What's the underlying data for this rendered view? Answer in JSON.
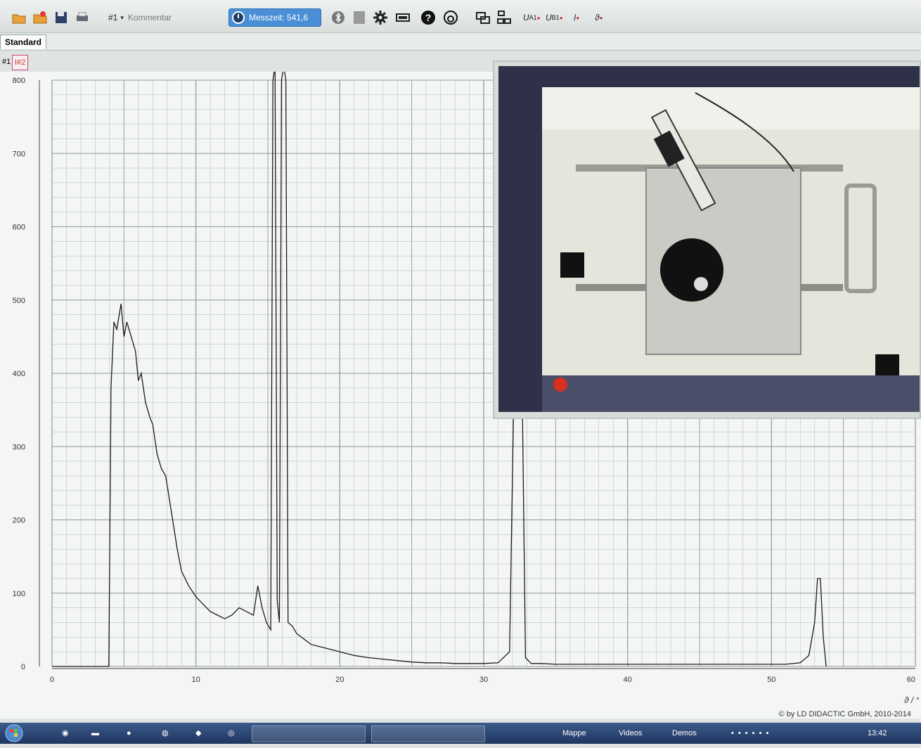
{
  "toolbar": {
    "channel": "#1",
    "comment": "Kommentar",
    "measure_time": "Messzeit: 541,6",
    "ua1": "U",
    "ua1_sub": "A1",
    "ub1": "U",
    "ub1_sub": "B1",
    "i_label": "I",
    "theta_label": "ϑ"
  },
  "tabs": {
    "standard": "Standard"
  },
  "subtabs": {
    "first": "#1",
    "second": "I#2"
  },
  "chart_data": {
    "type": "line",
    "xlabel": "ϑ / °",
    "ylabel": "",
    "xlim": [
      0,
      60
    ],
    "ylim": [
      0,
      800
    ],
    "x_ticks": [
      0,
      10,
      20,
      30,
      40,
      50,
      60
    ],
    "y_ticks": [
      0,
      100,
      200,
      300,
      400,
      500,
      600,
      700,
      800
    ],
    "grid": true,
    "series": [
      {
        "x": [
          0,
          1,
          2,
          3,
          3.95,
          4.1,
          4.3,
          4.5,
          4.8,
          5.0,
          5.2,
          5.5,
          5.8,
          6.0,
          6.2,
          6.5,
          6.8,
          7.0,
          7.3,
          7.6,
          7.9,
          8.3,
          8.7,
          9.0,
          9.5,
          10.0,
          10.5,
          11.0,
          11.5,
          12.0,
          12.5,
          13.0,
          13.5,
          14.0,
          14.3,
          14.6,
          14.9,
          15.2,
          15.35,
          15.5,
          15.65,
          15.8,
          15.95,
          16.1,
          16.25,
          16.4,
          16.7,
          17.0,
          18,
          19,
          20,
          21,
          22,
          23,
          24,
          25,
          26,
          27,
          28,
          29,
          30,
          31,
          31.8,
          32.2,
          32.4,
          32.6,
          32.9,
          33.3,
          34,
          35,
          36,
          37,
          38,
          39,
          40,
          41,
          42,
          43,
          44,
          45,
          46,
          47,
          48,
          49,
          50,
          51,
          52,
          52.6,
          53.0,
          53.2,
          53.4,
          53.6,
          53.8
        ],
        "y": [
          0,
          0,
          0,
          0,
          0,
          380,
          470,
          460,
          495,
          450,
          470,
          450,
          430,
          390,
          400,
          360,
          340,
          330,
          290,
          270,
          260,
          210,
          160,
          130,
          110,
          95,
          85,
          75,
          70,
          65,
          70,
          80,
          75,
          70,
          110,
          80,
          60,
          50,
          800,
          1500,
          90,
          60,
          800,
          1500,
          800,
          60,
          55,
          45,
          30,
          25,
          20,
          15,
          12,
          10,
          8,
          6,
          5,
          5,
          4,
          4,
          4,
          5,
          20,
          500,
          1200,
          500,
          12,
          4,
          4,
          3,
          3,
          3,
          3,
          3,
          3,
          3,
          3,
          3,
          3,
          3,
          3,
          3,
          3,
          3,
          3,
          3,
          5,
          15,
          60,
          120,
          120,
          40,
          0
        ]
      }
    ]
  },
  "copyright": "© by LD DIDACTIC GmbH, 2010-2014",
  "taskbar": {
    "item1": "Mappe",
    "item2": "Videos",
    "item3": "Demos",
    "clock": "13:42"
  }
}
